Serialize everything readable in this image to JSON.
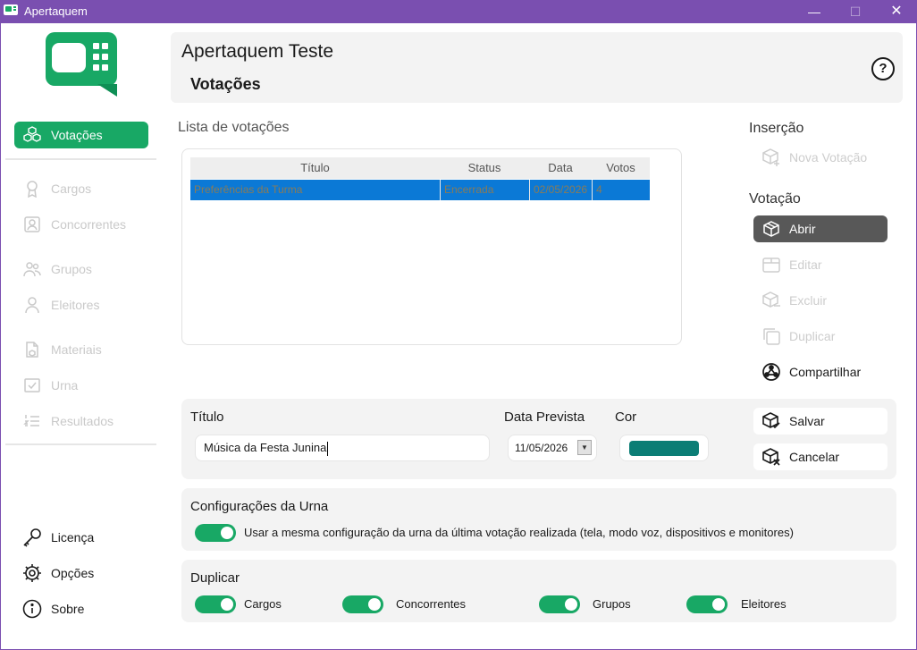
{
  "window": {
    "title": "Apertaquem",
    "minimize": "—",
    "maximize": "☐",
    "close": "✕"
  },
  "colors": {
    "accent": "#18a865",
    "titlebar": "#7a4fb0",
    "selection": "#0b79d6",
    "vote_color": "#0b7d75"
  },
  "sidebar": {
    "items": [
      {
        "label": "Votações",
        "icon": "cubes-icon"
      },
      {
        "label": "Cargos",
        "icon": "award-icon"
      },
      {
        "label": "Concorrentes",
        "icon": "contact-card-icon"
      },
      {
        "label": "Grupos",
        "icon": "group-icon"
      },
      {
        "label": "Eleitores",
        "icon": "person-icon"
      },
      {
        "label": "Materiais",
        "icon": "document-box-icon"
      },
      {
        "label": "Urna",
        "icon": "checkbox-icon"
      },
      {
        "label": "Resultados",
        "icon": "list-numbered-icon"
      },
      {
        "label": "Licença",
        "icon": "key-icon"
      },
      {
        "label": "Opções",
        "icon": "gear-icon"
      },
      {
        "label": "Sobre",
        "icon": "info-icon"
      }
    ]
  },
  "header": {
    "app_title": "Apertaquem Teste",
    "page_title": "Votações",
    "help": "?"
  },
  "list": {
    "title": "Lista de votações",
    "columns": [
      "Título",
      "Status",
      "Data",
      "Votos"
    ],
    "rows": [
      {
        "titulo": "Preferências da Turma",
        "status": "Encerrada",
        "data": "02/05/2026",
        "votos": "4"
      }
    ]
  },
  "actions": {
    "insercao_label": "Inserção",
    "nova_votacao": "Nova Votação",
    "votacao_label": "Votação",
    "abrir": "Abrir",
    "editar": "Editar",
    "excluir": "Excluir",
    "duplicar": "Duplicar",
    "compartilhar": "Compartilhar",
    "salvar": "Salvar",
    "cancelar": "Cancelar"
  },
  "form": {
    "titulo_label": "Título",
    "titulo_value": "Música da Festa Junina",
    "data_label": "Data Prevista",
    "data_value": "11/05/2026",
    "cor_label": "Cor"
  },
  "urna": {
    "title": "Configurações da Urna",
    "toggle_label": "Usar a mesma configuração da urna da última votação realizada (tela, modo voz, dispositivos e monitores)",
    "toggle_on": true
  },
  "duplicar": {
    "title": "Duplicar",
    "toggles": [
      {
        "label": "Cargos",
        "on": true
      },
      {
        "label": "Concorrentes",
        "on": true
      },
      {
        "label": "Grupos",
        "on": true
      },
      {
        "label": "Eleitores",
        "on": true
      }
    ]
  }
}
